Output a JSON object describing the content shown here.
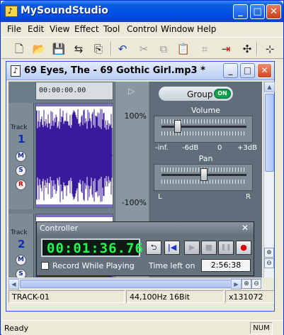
{
  "app": {
    "title": "MySoundStudio",
    "icon_glyph": "♪"
  },
  "caption_buttons": {
    "minimize": "_",
    "maximize": "□",
    "close": "✕"
  },
  "menu": [
    "File",
    "Edit",
    "View",
    "Effect",
    "Tool",
    "Control",
    "Window",
    "Help"
  ],
  "toolbar": {
    "icons": [
      "new-file-icon",
      "open-folder-icon",
      "save-icon",
      "import-icon",
      "export-icon",
      "undo-icon",
      "cut-icon",
      "copy-icon",
      "paste-icon",
      "crop-icon",
      "insert-track-icon",
      "effects-icon",
      "zoom-tool-icon"
    ],
    "glyphs": [
      "🗋",
      "📂",
      "💾",
      "⇆",
      "⎘",
      "↶",
      "✂",
      "⧉",
      "📋",
      "⌗",
      "⇥",
      "✣",
      "⊹"
    ]
  },
  "document": {
    "title": "69 Eyes, The - 69 Gothic Girl.mp3 *",
    "icon_glyph": "♪"
  },
  "tracks": [
    {
      "label": "Track",
      "number": "1",
      "mute": "M",
      "solo": "S",
      "record": "R"
    },
    {
      "label": "Track",
      "number": "2",
      "mute": "M",
      "solo": "S"
    }
  ],
  "timeline": {
    "time": "00:00:00.00"
  },
  "play_marker": "▷",
  "levels": {
    "top": "100%",
    "bottom": "-100%"
  },
  "group": {
    "label": "Group",
    "state": "ON"
  },
  "volume": {
    "title": "Volume",
    "scale": [
      "-inf.",
      "-6dB",
      "0",
      "+3dB"
    ]
  },
  "pan": {
    "title": "Pan",
    "left": "L",
    "right": "R"
  },
  "controller": {
    "title": "Controller",
    "close": "✕",
    "display": "00:01:36.76",
    "buttons": {
      "loop": "⮌",
      "to_start": "|◀",
      "play": "▶",
      "stop": "■",
      "pause": "❚❚",
      "record": "●"
    },
    "record_while_playing": "Record While Playing",
    "time_left_label": "Time left on",
    "time_left": "2:56:38"
  },
  "zoom": {
    "in": "⊕",
    "out": "⊖"
  },
  "scroll_arrows": {
    "up": "▲",
    "down": "▼",
    "left": "◀",
    "right": "▶"
  },
  "doc_status": {
    "track": "TRACK-01",
    "format": "44,100Hz 16Bit",
    "zoom": "x131072"
  },
  "status": {
    "left": "Ready",
    "num": "NUM"
  },
  "colors": {
    "waveform": "#3a1a9c",
    "lcd": "#1bff4d",
    "group_on": "#0ea04a"
  }
}
